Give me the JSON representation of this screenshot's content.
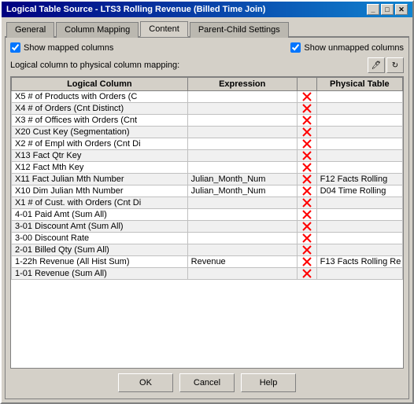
{
  "window": {
    "title": "Logical Table Source - LTS3 Rolling Revenue (Billed Time Join)",
    "title_btn_min": "_",
    "title_btn_max": "□",
    "title_btn_close": "✕"
  },
  "tabs": [
    {
      "label": "General",
      "active": false
    },
    {
      "label": "Column Mapping",
      "active": false
    },
    {
      "label": "Content",
      "active": true
    },
    {
      "label": "Parent-Child Settings",
      "active": false
    }
  ],
  "options": {
    "show_mapped": "Show mapped columns",
    "show_unmapped": "Show unmapped columns",
    "show_mapped_checked": true,
    "show_unmapped_checked": true,
    "mapping_label": "Logical column to physical column mapping:"
  },
  "table": {
    "headers": [
      "Logical Column",
      "Expression",
      "",
      "Physical Table"
    ],
    "rows": [
      {
        "logical": "X5  # of Products with Orders  (C",
        "expression": "",
        "has_x": true,
        "physical": ""
      },
      {
        "logical": "X4  # of Orders  (Cnt Distinct)",
        "expression": "",
        "has_x": true,
        "physical": ""
      },
      {
        "logical": "X3  # of Offices with Orders  (Cnt",
        "expression": "",
        "has_x": true,
        "physical": ""
      },
      {
        "logical": "X20 Cust Key (Segmentation)",
        "expression": "",
        "has_x": true,
        "physical": ""
      },
      {
        "logical": "X2  # of Empl with Orders  (Cnt Di",
        "expression": "",
        "has_x": true,
        "physical": ""
      },
      {
        "logical": "X13 Fact Qtr Key",
        "expression": "",
        "has_x": true,
        "physical": ""
      },
      {
        "logical": "X12 Fact Mth Key",
        "expression": "",
        "has_x": true,
        "physical": ""
      },
      {
        "logical": "X11 Fact Julian Mth Number",
        "expression": "Julian_Month_Num",
        "has_x": true,
        "physical": "F12 Facts Rolling"
      },
      {
        "logical": "X10 Dim Julian Mth Number",
        "expression": "Julian_Month_Num",
        "has_x": true,
        "physical": "D04 Time Rolling"
      },
      {
        "logical": "X1  # of Cust. with Orders  (Cnt Di",
        "expression": "",
        "has_x": true,
        "physical": ""
      },
      {
        "logical": "4-01  Paid Amt  (Sum All)",
        "expression": "",
        "has_x": true,
        "physical": ""
      },
      {
        "logical": "3-01  Discount Amt  (Sum All)",
        "expression": "",
        "has_x": true,
        "physical": ""
      },
      {
        "logical": "3-00  Discount Rate",
        "expression": "",
        "has_x": true,
        "physical": ""
      },
      {
        "logical": "2-01  Billed Qty  (Sum All)",
        "expression": "",
        "has_x": true,
        "physical": ""
      },
      {
        "logical": "1-22h  Revenue  (All Hist Sum)",
        "expression": "Revenue",
        "has_x": true,
        "physical": "F13 Facts Rolling Re"
      },
      {
        "logical": "1-01  Revenue  (Sum All)",
        "expression": "",
        "has_x": true,
        "physical": ""
      }
    ]
  },
  "buttons": {
    "ok": "OK",
    "cancel": "Cancel",
    "help": "Help"
  }
}
